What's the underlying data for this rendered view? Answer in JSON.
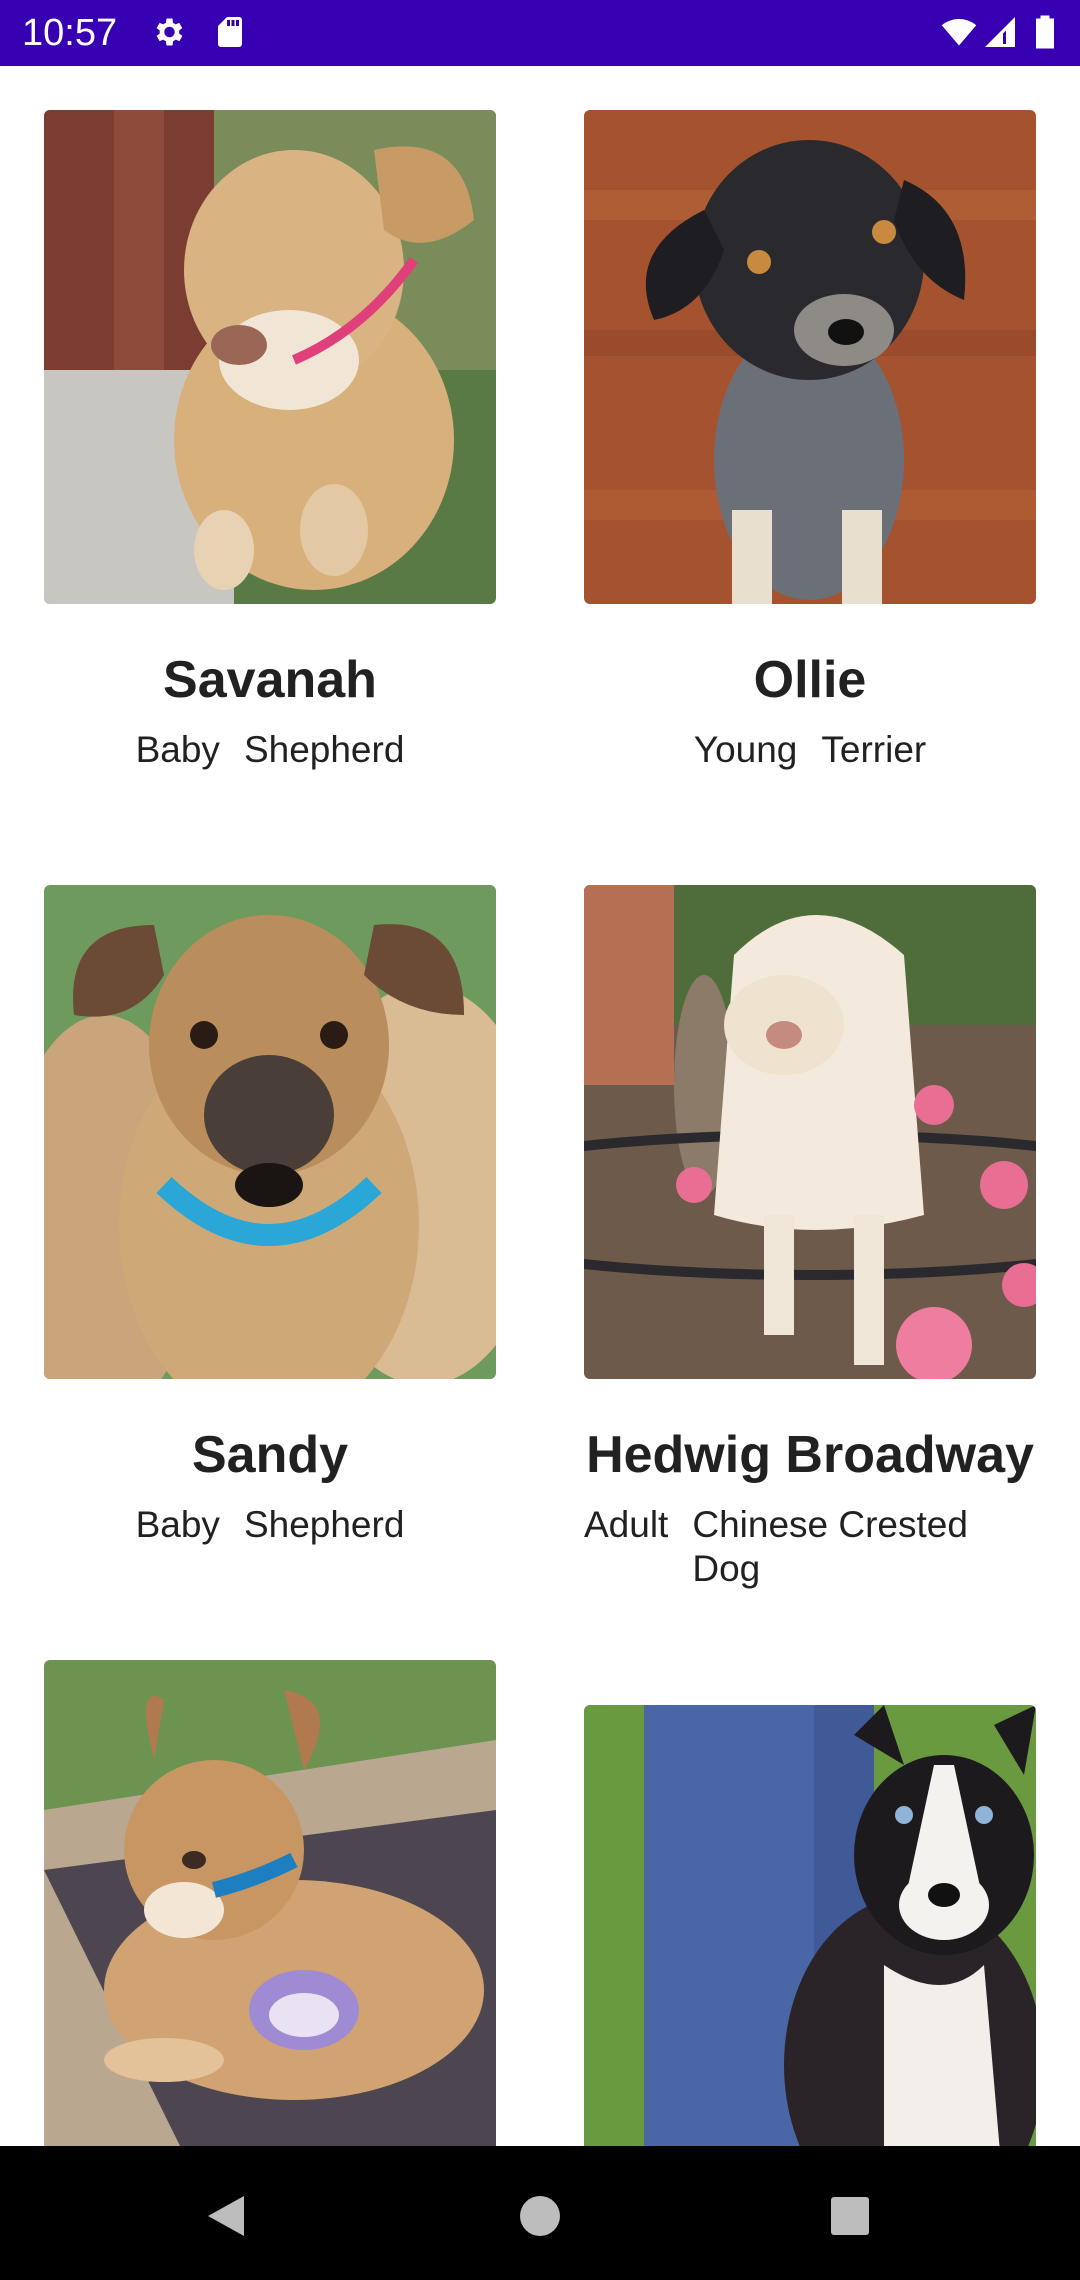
{
  "status_bar": {
    "time": "10:57",
    "left_icons": [
      "gear-icon",
      "sd-card-icon"
    ],
    "right_icons": [
      "wifi-icon",
      "signal-icon",
      "battery-icon"
    ],
    "background": "#3700b3"
  },
  "pets": [
    {
      "name": "Savanah",
      "age": "Baby",
      "breed": "Shepherd",
      "photo": "tan-puppy-pink-collar"
    },
    {
      "name": "Ollie",
      "age": "Young",
      "breed": "Terrier",
      "photo": "black-terrier-on-wood-floor"
    },
    {
      "name": "Sandy",
      "age": "Baby",
      "breed": "Shepherd",
      "photo": "tan-puppy-blue-collar"
    },
    {
      "name": "Hedwig Broadway",
      "age": "Adult",
      "breed": "Chinese Crested Dog",
      "photo": "white-longhair-dog-roses"
    },
    {
      "name": "",
      "age": "",
      "breed": "",
      "photo": "tan-puppy-on-cot"
    },
    {
      "name": "",
      "age": "",
      "breed": "",
      "photo": "black-white-dog-on-grass"
    }
  ],
  "nav_bar": {
    "buttons": [
      "back-icon",
      "home-icon",
      "recents-icon"
    ]
  }
}
